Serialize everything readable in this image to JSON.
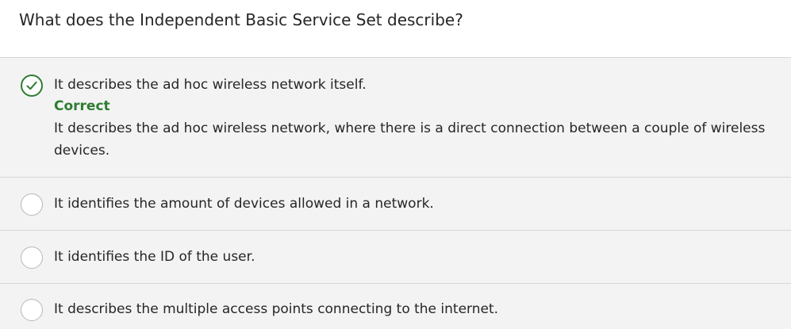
{
  "question": {
    "text": "What does the Independent Basic Service Set describe?"
  },
  "options": [
    {
      "text": "It describes the ad hoc wireless network itself.",
      "selected": true,
      "verdict": "Correct",
      "explanation": "It describes the ad hoc wireless network, where there is a direct connection between a couple of wireless devices."
    },
    {
      "text": "It identifies the amount of devices allowed in a network.",
      "selected": false
    },
    {
      "text": "It identifies the ID of the user.",
      "selected": false
    },
    {
      "text": "It describes the multiple access points connecting to the internet.",
      "selected": false
    }
  ],
  "colors": {
    "correct": "#2e7d32",
    "option_background": "#f3f3f3",
    "divider": "#d6d6d6"
  },
  "icons": {
    "selected_option": "checkmark-circle-icon",
    "unselected_option": "empty-radio-icon"
  }
}
